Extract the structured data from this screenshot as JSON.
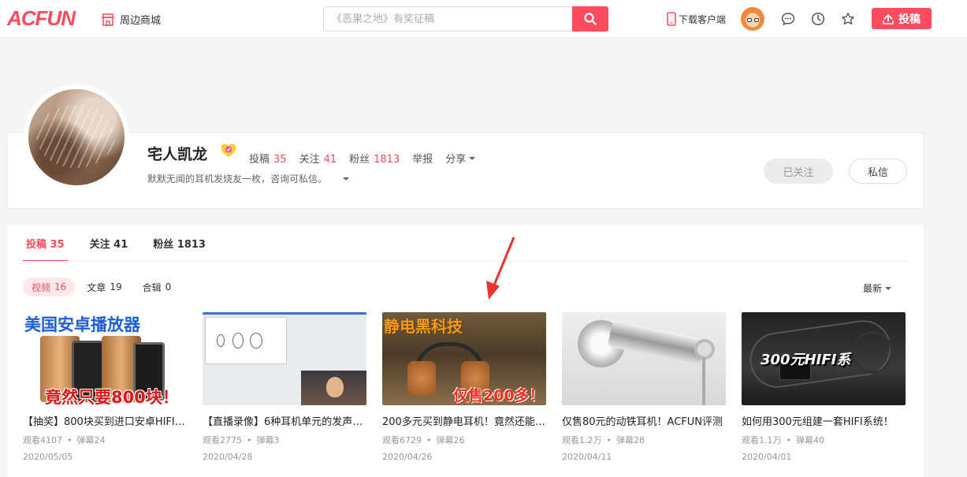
{
  "header": {
    "logo": "ACFUN",
    "shop_label": "周边商城",
    "search_placeholder": "《恶果之地》有奖征稿",
    "download_label": "下载客户端",
    "upload_label": "投稿"
  },
  "profile": {
    "name": "宅人凯龙",
    "stats": [
      {
        "label": "投稿",
        "value": "35"
      },
      {
        "label": "关注",
        "value": "41"
      },
      {
        "label": "粉丝",
        "value": "1813"
      }
    ],
    "report_label": "举报",
    "share_label": "分享",
    "bio": "默默无闻的耳机发烧友一枚，咨询可私信。",
    "followed_label": "已关注",
    "message_label": "私信"
  },
  "tabs": [
    {
      "label": "投稿 35"
    },
    {
      "label": "关注 41"
    },
    {
      "label": "粉丝 1813"
    }
  ],
  "subtabs": [
    {
      "label": "视频",
      "count": "16"
    },
    {
      "label": "文章",
      "count": "19"
    },
    {
      "label": "合辑",
      "count": "0"
    }
  ],
  "sort_label": "最新",
  "videos": [
    {
      "title": "【抽奖】800块买到进口安卓HIFI播放器",
      "views": "观看4107",
      "danmu": "弹幕24",
      "date": "2020/05/05",
      "thumb_top_text": "美国安卓播放器",
      "thumb_bottom_text": "竟然只要800块！"
    },
    {
      "title": "【直播录像】6种耳机单元的发声原理",
      "views": "观看2775",
      "danmu": "弹幕3",
      "date": "2020/04/28"
    },
    {
      "title": "200多元买到静电耳机！竟然还能这样",
      "views": "观看6729",
      "danmu": "弹幕26",
      "date": "2020/04/26",
      "thumb_top_text": "静电黑科技",
      "thumb_bottom_text": "仅售200多！"
    },
    {
      "title": "仅售80元的动铁耳机！ACFUN评测",
      "views": "观看1.2万",
      "danmu": "弹幕28",
      "date": "2020/04/11"
    },
    {
      "title": "如何用300元组建一套HIFI系统！",
      "views": "观看1.1万",
      "danmu": "弹幕40",
      "date": "2020/04/01",
      "thumb_top_text": "300元HIFI系"
    }
  ]
}
